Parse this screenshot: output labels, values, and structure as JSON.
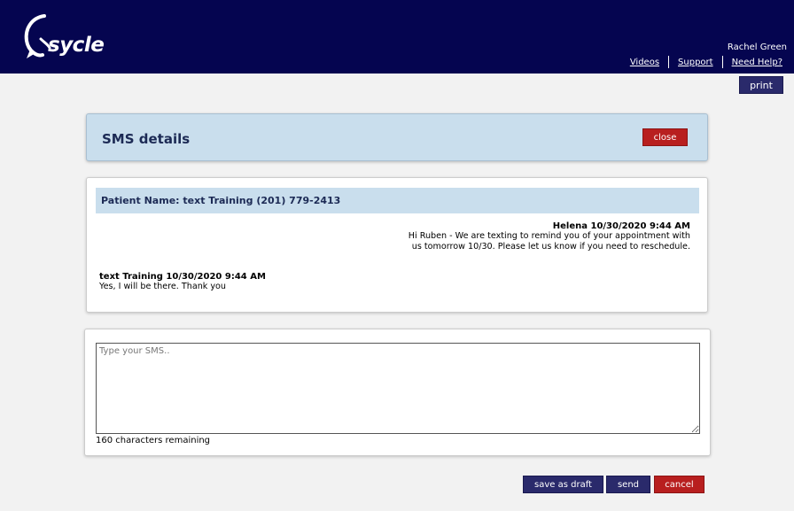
{
  "header": {
    "logo_text": "sycle",
    "user_name": "Rachel Green",
    "links": [
      "Videos",
      "Support",
      "Need Help?"
    ]
  },
  "toolbar": {
    "print_label": "print"
  },
  "details": {
    "title": "SMS details",
    "close_label": "close"
  },
  "conversation": {
    "patient_label": "Patient Name: text Training (201) 779-2413",
    "outgoing": {
      "meta": "Helena 10/30/2020 9:44 AM",
      "body": "Hi Ruben - We are texting to remind you of your appointment with us tomorrow 10/30. Please let us know if you need to reschedule."
    },
    "incoming": {
      "meta": "text Training 10/30/2020 9:44 AM",
      "body": "Yes, I will be there. Thank you"
    }
  },
  "compose": {
    "placeholder": "Type your SMS..",
    "value": "",
    "chars_remaining": "160 characters remaining"
  },
  "actions": {
    "save_draft_label": "save as draft",
    "send_label": "send",
    "cancel_label": "cancel"
  },
  "colors": {
    "topbar": "#050550",
    "header_panel": "#c9deed",
    "primary_button": "#2a2a6b",
    "danger_button": "#b81f1f"
  }
}
